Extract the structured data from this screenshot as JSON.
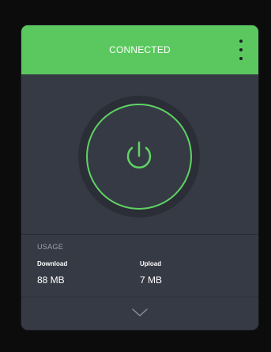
{
  "header": {
    "status": "CONNECTED",
    "menu_icon": "kebab-menu-icon"
  },
  "power": {
    "icon": "power-icon"
  },
  "usage": {
    "title": "USAGE",
    "download_label": "Download",
    "download_value": "88 MB",
    "upload_label": "Upload",
    "upload_value": "7 MB"
  },
  "footer": {
    "expand_icon": "chevron-down-icon"
  },
  "colors": {
    "connected_green": "#5ac85e",
    "ring_green": "#5fd365",
    "panel_bg": "#363a44"
  }
}
